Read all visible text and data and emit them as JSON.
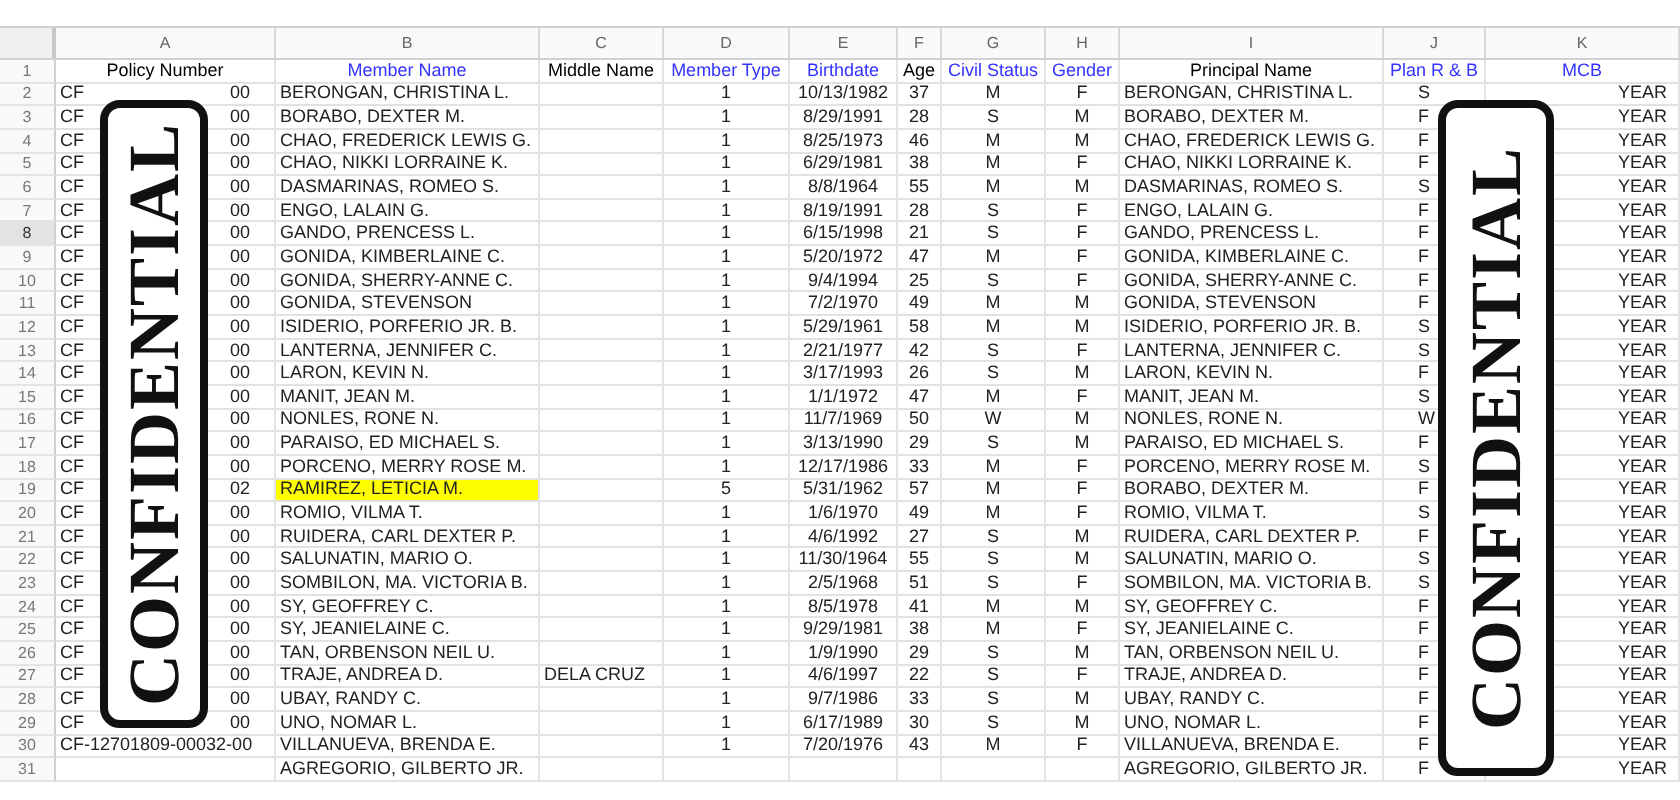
{
  "column_letters": [
    "A",
    "B",
    "C",
    "D",
    "E",
    "F",
    "G",
    "H",
    "I",
    "J",
    "K"
  ],
  "header_row": {
    "number": "1",
    "cells": [
      {
        "text": "Policy Number",
        "color": "#000000"
      },
      {
        "text": "Member Name",
        "color": "#3333ff"
      },
      {
        "text": "Middle Name",
        "color": "#000000"
      },
      {
        "text": "Member Type",
        "color": "#3333ff"
      },
      {
        "text": "Birthdate",
        "color": "#3333ff"
      },
      {
        "text": "Age",
        "color": "#000000"
      },
      {
        "text": "Civil Status",
        "color": "#3333ff"
      },
      {
        "text": "Gender",
        "color": "#3333ff"
      },
      {
        "text": "Principal Name",
        "color": "#000000"
      },
      {
        "text": "Plan R & B",
        "color": "#3333ff"
      },
      {
        "text": "MCB",
        "color": "#3333ff"
      }
    ]
  },
  "rows": [
    {
      "number": "2",
      "selected": false,
      "highlighted": false,
      "policy_number_parts": [
        "CF",
        "00"
      ],
      "member_name": "BERONGAN, CHRISTINA L.",
      "member_type": "1",
      "birthdate": "10/13/1982",
      "age": "37",
      "civil_status": "M",
      "gender": "F",
      "principal_name": "BERONGAN, CHRISTINA L.",
      "plan_rb": "S",
      "mcb": "YEAR"
    },
    {
      "number": "3",
      "selected": false,
      "highlighted": false,
      "policy_number_parts": [
        "CF",
        "00"
      ],
      "member_name": "BORABO, DEXTER M.",
      "member_type": "1",
      "birthdate": "8/29/1991",
      "age": "28",
      "civil_status": "S",
      "gender": "M",
      "principal_name": "BORABO, DEXTER M.",
      "plan_rb": "F",
      "mcb": "YEAR"
    },
    {
      "number": "4",
      "selected": false,
      "highlighted": false,
      "policy_number_parts": [
        "CF",
        "00"
      ],
      "member_name": "CHAO, FREDERICK LEWIS G.",
      "member_type": "1",
      "birthdate": "8/25/1973",
      "age": "46",
      "civil_status": "M",
      "gender": "M",
      "principal_name": "CHAO, FREDERICK LEWIS G.",
      "plan_rb": "F",
      "mcb": "YEAR"
    },
    {
      "number": "5",
      "selected": false,
      "highlighted": false,
      "policy_number_parts": [
        "CF",
        "00"
      ],
      "member_name": "CHAO, NIKKI LORRAINE K.",
      "member_type": "1",
      "birthdate": "6/29/1981",
      "age": "38",
      "civil_status": "M",
      "gender": "F",
      "principal_name": "CHAO, NIKKI LORRAINE K.",
      "plan_rb": "F",
      "mcb": "YEAR"
    },
    {
      "number": "6",
      "selected": false,
      "highlighted": false,
      "policy_number_parts": [
        "CF",
        "00"
      ],
      "member_name": "DASMARINAS, ROMEO S.",
      "member_type": "1",
      "birthdate": "8/8/1964",
      "age": "55",
      "civil_status": "M",
      "gender": "M",
      "principal_name": "DASMARINAS, ROMEO S.",
      "plan_rb": "S",
      "mcb": "YEAR"
    },
    {
      "number": "7",
      "selected": false,
      "highlighted": false,
      "policy_number_parts": [
        "CF",
        "00"
      ],
      "member_name": "ENGO, LALAIN G.",
      "member_type": "1",
      "birthdate": "8/19/1991",
      "age": "28",
      "civil_status": "S",
      "gender": "F",
      "principal_name": "ENGO, LALAIN G.",
      "plan_rb": "F",
      "mcb": "YEAR"
    },
    {
      "number": "8",
      "selected": true,
      "highlighted": false,
      "policy_number_parts": [
        "CF",
        "00"
      ],
      "member_name": "GANDO, PRENCESS L.",
      "member_type": "1",
      "birthdate": "6/15/1998",
      "age": "21",
      "civil_status": "S",
      "gender": "F",
      "principal_name": "GANDO, PRENCESS L.",
      "plan_rb": "F",
      "mcb": "YEAR"
    },
    {
      "number": "9",
      "selected": false,
      "highlighted": false,
      "policy_number_parts": [
        "CF",
        "00"
      ],
      "member_name": "GONIDA, KIMBERLAINE C.",
      "member_type": "1",
      "birthdate": "5/20/1972",
      "age": "47",
      "civil_status": "M",
      "gender": "F",
      "principal_name": "GONIDA, KIMBERLAINE C.",
      "plan_rb": "F",
      "mcb": "YEAR"
    },
    {
      "number": "10",
      "selected": false,
      "highlighted": false,
      "policy_number_parts": [
        "CF",
        "00"
      ],
      "member_name": "GONIDA, SHERRY-ANNE C.",
      "member_type": "1",
      "birthdate": "9/4/1994",
      "age": "25",
      "civil_status": "S",
      "gender": "F",
      "principal_name": "GONIDA, SHERRY-ANNE C.",
      "plan_rb": "F",
      "mcb": "YEAR"
    },
    {
      "number": "11",
      "selected": false,
      "highlighted": false,
      "policy_number_parts": [
        "CF",
        "00"
      ],
      "member_name": "GONIDA, STEVENSON",
      "member_type": "1",
      "birthdate": "7/2/1970",
      "age": "49",
      "civil_status": "M",
      "gender": "M",
      "principal_name": "GONIDA, STEVENSON",
      "plan_rb": "F",
      "mcb": "YEAR"
    },
    {
      "number": "12",
      "selected": false,
      "highlighted": false,
      "policy_number_parts": [
        "CF",
        "00"
      ],
      "member_name": "ISIDERIO, PORFERIO JR. B.",
      "member_type": "1",
      "birthdate": "5/29/1961",
      "age": "58",
      "civil_status": "M",
      "gender": "M",
      "principal_name": "ISIDERIO, PORFERIO JR. B.",
      "plan_rb": "S",
      "mcb": "YEAR"
    },
    {
      "number": "13",
      "selected": false,
      "highlighted": false,
      "policy_number_parts": [
        "CF",
        "00"
      ],
      "member_name": "LANTERNA, JENNIFER C.",
      "member_type": "1",
      "birthdate": "2/21/1977",
      "age": "42",
      "civil_status": "S",
      "gender": "F",
      "principal_name": "LANTERNA, JENNIFER C.",
      "plan_rb": "S",
      "mcb": "YEAR"
    },
    {
      "number": "14",
      "selected": false,
      "highlighted": false,
      "policy_number_parts": [
        "CF",
        "00"
      ],
      "member_name": "LARON, KEVIN N.",
      "member_type": "1",
      "birthdate": "3/17/1993",
      "age": "26",
      "civil_status": "S",
      "gender": "M",
      "principal_name": "LARON, KEVIN N.",
      "plan_rb": "F",
      "mcb": "YEAR"
    },
    {
      "number": "15",
      "selected": false,
      "highlighted": false,
      "policy_number_parts": [
        "CF",
        "00"
      ],
      "member_name": "MANIT, JEAN M.",
      "member_type": "1",
      "birthdate": "1/1/1972",
      "age": "47",
      "civil_status": "M",
      "gender": "F",
      "principal_name": "MANIT, JEAN M.",
      "plan_rb": "S",
      "mcb": "YEAR"
    },
    {
      "number": "16",
      "selected": false,
      "highlighted": false,
      "policy_number_parts": [
        "CF",
        "00"
      ],
      "member_name": "NONLES, RONE N.",
      "member_type": "1",
      "birthdate": "11/7/1969",
      "age": "50",
      "civil_status": "W",
      "gender": "M",
      "principal_name": "NONLES, RONE N.",
      "plan_rb": "W",
      "mcb": "YEAR"
    },
    {
      "number": "17",
      "selected": false,
      "highlighted": false,
      "policy_number_parts": [
        "CF",
        "00"
      ],
      "member_name": "PARAISO, ED MICHAEL S.",
      "member_type": "1",
      "birthdate": "3/13/1990",
      "age": "29",
      "civil_status": "S",
      "gender": "M",
      "principal_name": "PARAISO, ED MICHAEL S.",
      "plan_rb": "F",
      "mcb": "YEAR"
    },
    {
      "number": "18",
      "selected": false,
      "highlighted": false,
      "policy_number_parts": [
        "CF",
        "00"
      ],
      "member_name": "PORCENO, MERRY ROSE M.",
      "member_type": "1",
      "birthdate": "12/17/1986",
      "age": "33",
      "civil_status": "M",
      "gender": "F",
      "principal_name": "PORCENO, MERRY ROSE M.",
      "plan_rb": "S",
      "mcb": "YEAR"
    },
    {
      "number": "19",
      "selected": false,
      "highlighted": true,
      "policy_number_parts": [
        "CF",
        "02"
      ],
      "member_name": "RAMIREZ, LETICIA M.",
      "member_type": "5",
      "birthdate": "5/31/1962",
      "age": "57",
      "civil_status": "M",
      "gender": "F",
      "principal_name": "BORABO, DEXTER M.",
      "plan_rb": "F",
      "mcb": "YEAR"
    },
    {
      "number": "20",
      "selected": false,
      "highlighted": false,
      "policy_number_parts": [
        "CF",
        "00"
      ],
      "member_name": "ROMIO, VILMA T.",
      "member_type": "1",
      "birthdate": "1/6/1970",
      "age": "49",
      "civil_status": "M",
      "gender": "F",
      "principal_name": "ROMIO, VILMA T.",
      "plan_rb": "S",
      "mcb": "YEAR"
    },
    {
      "number": "21",
      "selected": false,
      "highlighted": false,
      "policy_number_parts": [
        "CF",
        "00"
      ],
      "member_name": "RUIDERA, CARL DEXTER P.",
      "member_type": "1",
      "birthdate": "4/6/1992",
      "age": "27",
      "civil_status": "S",
      "gender": "M",
      "principal_name": "RUIDERA, CARL DEXTER P.",
      "plan_rb": "F",
      "mcb": "YEAR"
    },
    {
      "number": "22",
      "selected": false,
      "highlighted": false,
      "policy_number_parts": [
        "CF",
        "00"
      ],
      "member_name": "SALUNATIN, MARIO O.",
      "member_type": "1",
      "birthdate": "11/30/1964",
      "age": "55",
      "civil_status": "S",
      "gender": "M",
      "principal_name": "SALUNATIN, MARIO O.",
      "plan_rb": "S",
      "mcb": "YEAR"
    },
    {
      "number": "23",
      "selected": false,
      "highlighted": false,
      "policy_number_parts": [
        "CF",
        "00"
      ],
      "member_name": "SOMBILON, MA. VICTORIA B.",
      "member_type": "1",
      "birthdate": "2/5/1968",
      "age": "51",
      "civil_status": "S",
      "gender": "F",
      "principal_name": "SOMBILON, MA. VICTORIA B.",
      "plan_rb": "S",
      "mcb": "YEAR"
    },
    {
      "number": "24",
      "selected": false,
      "highlighted": false,
      "policy_number_parts": [
        "CF",
        "00"
      ],
      "member_name": "SY, GEOFFREY C.",
      "member_type": "1",
      "birthdate": "8/5/1978",
      "age": "41",
      "civil_status": "M",
      "gender": "M",
      "principal_name": "SY, GEOFFREY C.",
      "plan_rb": "F",
      "mcb": "YEAR"
    },
    {
      "number": "25",
      "selected": false,
      "highlighted": false,
      "policy_number_parts": [
        "CF",
        "00"
      ],
      "member_name": "SY, JEANIELAINE C.",
      "member_type": "1",
      "birthdate": "9/29/1981",
      "age": "38",
      "civil_status": "M",
      "gender": "F",
      "principal_name": "SY, JEANIELAINE C.",
      "plan_rb": "F",
      "mcb": "YEAR"
    },
    {
      "number": "26",
      "selected": false,
      "highlighted": false,
      "policy_number_parts": [
        "CF",
        "00"
      ],
      "member_name": "TAN, ORBENSON NEIL U.",
      "member_type": "1",
      "birthdate": "1/9/1990",
      "age": "29",
      "civil_status": "S",
      "gender": "M",
      "principal_name": "TAN, ORBENSON NEIL U.",
      "plan_rb": "F",
      "mcb": "YEAR"
    },
    {
      "number": "27",
      "selected": false,
      "highlighted": false,
      "policy_number_parts": [
        "CF",
        "00"
      ],
      "member_name": "TRAJE, ANDREA D.",
      "middle_name": "DELA CRUZ",
      "member_type": "1",
      "birthdate": "4/6/1997",
      "age": "22",
      "civil_status": "S",
      "gender": "F",
      "principal_name": "TRAJE, ANDREA D.",
      "plan_rb": "F",
      "mcb": "YEAR"
    },
    {
      "number": "28",
      "selected": false,
      "highlighted": false,
      "policy_number_parts": [
        "CF",
        "00"
      ],
      "member_name": "UBAY, RANDY C.",
      "member_type": "1",
      "birthdate": "9/7/1986",
      "age": "33",
      "civil_status": "S",
      "gender": "M",
      "principal_name": "UBAY, RANDY C.",
      "plan_rb": "F",
      "mcb": "YEAR"
    },
    {
      "number": "29",
      "selected": false,
      "highlighted": false,
      "policy_number_parts": [
        "CF",
        "00"
      ],
      "member_name": "UNO, NOMAR L.",
      "member_type": "1",
      "birthdate": "6/17/1989",
      "age": "30",
      "civil_status": "S",
      "gender": "M",
      "principal_name": "UNO, NOMAR L.",
      "plan_rb": "F",
      "mcb": "YEAR"
    },
    {
      "number": "30",
      "selected": false,
      "highlighted": false,
      "policy_number_parts": [
        "CF-12701809-00032-00"
      ],
      "member_name": "VILLANUEVA, BRENDA E.",
      "member_type": "1",
      "birthdate": "7/20/1976",
      "age": "43",
      "civil_status": "M",
      "gender": "F",
      "principal_name": "VILLANUEVA, BRENDA E.",
      "plan_rb": "F",
      "mcb": "YEAR"
    },
    {
      "number": "31",
      "selected": false,
      "highlighted": false,
      "member_name": "AGREGORIO, GILBERTO JR.",
      "principal_name": "AGREGORIO, GILBERTO JR.",
      "plan_rb": "F",
      "mcb": "YEAR"
    }
  ],
  "stamps": [
    {
      "text": "CONFIDENTIAL"
    },
    {
      "text": "CONFIDENTIAL"
    }
  ]
}
